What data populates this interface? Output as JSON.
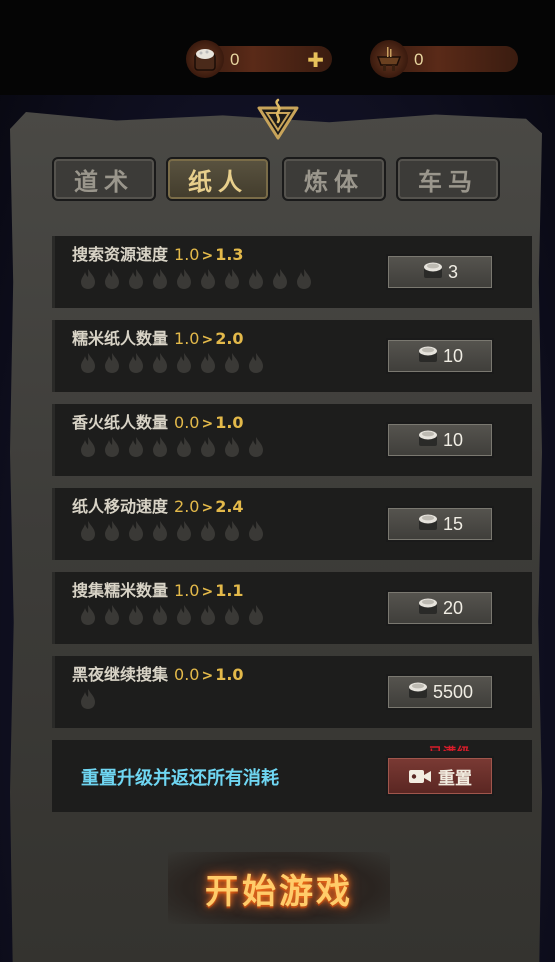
{
  "currency": [
    {
      "icon": "rice-bag-icon",
      "value": "0",
      "has_plus": true
    },
    {
      "icon": "incense-burner-icon",
      "value": "0",
      "has_plus": false
    }
  ],
  "emblem_icon": "talisman-emblem-icon",
  "tabs": [
    {
      "label": "道术",
      "active": false
    },
    {
      "label": "纸人",
      "active": true
    },
    {
      "label": "炼体",
      "active": false
    },
    {
      "label": "车马",
      "active": false
    }
  ],
  "upgrades": [
    {
      "name": "搜索资源速度",
      "from": "1.0",
      "arrow": ">",
      "to": "1.3",
      "flames": 10,
      "cost": "3"
    },
    {
      "name": "糯米纸人数量",
      "from": "1.0",
      "arrow": ">",
      "to": "2.0",
      "flames": 8,
      "cost": "10"
    },
    {
      "name": "香火纸人数量",
      "from": "0.0",
      "arrow": ">",
      "to": "1.0",
      "flames": 8,
      "cost": "10"
    },
    {
      "name": "纸人移动速度",
      "from": "2.0",
      "arrow": ">",
      "to": "2.4",
      "flames": 8,
      "cost": "15"
    },
    {
      "name": "搜集糯米数量",
      "from": "1.0",
      "arrow": ">",
      "to": "1.1",
      "flames": 8,
      "cost": "20"
    },
    {
      "name": "黑夜继续搜集",
      "from": "0.0",
      "arrow": ">",
      "to": "1.0",
      "flames": 1,
      "cost": "5500"
    }
  ],
  "reset": {
    "text": "重置升级并返还所有消耗",
    "button_label": "重置",
    "tag": "已满级"
  },
  "start_button": "开始游戏",
  "colors": {
    "value_gold": "#e3b94a",
    "reset_cyan": "#6fd6f2",
    "tag_red": "#d81c2a"
  }
}
